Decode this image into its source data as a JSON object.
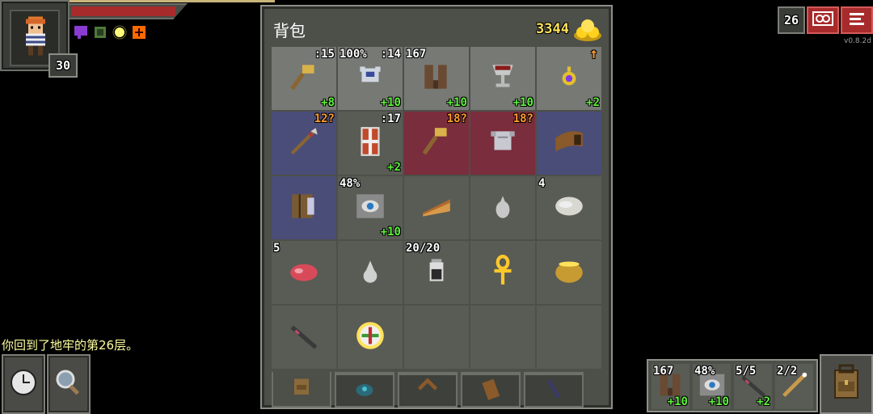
{
  "hero": {
    "level": "30",
    "hp_fraction": 0.92
  },
  "buffs": [
    "purple-buff-icon",
    "green-buff-icon",
    "light-buff-icon",
    "bless-buff-icon"
  ],
  "depth": "26",
  "version": "v0.8.2d",
  "log": {
    "message": "你回到了地牢的第26层。"
  },
  "bag": {
    "title": "背包",
    "gold": "3344",
    "slots": [
      {
        "icon": "hammer-icon",
        "style": "bright",
        "tl": "",
        "tr": ":15",
        "br": "+8"
      },
      {
        "icon": "armor-icon",
        "style": "bright",
        "tl": "100%",
        "tr": ":14",
        "br": "+10"
      },
      {
        "icon": "boots-icon",
        "style": "bright",
        "tl": "167",
        "tr": "",
        "br": "+10"
      },
      {
        "icon": "goblet-icon",
        "style": "bright",
        "tl": "",
        "tr": "",
        "br": "+10"
      },
      {
        "icon": "amulet-icon",
        "style": "bright",
        "tl": "",
        "tr": "↑",
        "br": "+2"
      },
      {
        "icon": "spear-icon",
        "style": "blue",
        "tl": "",
        "tr": "12?",
        "br": ""
      },
      {
        "icon": "shield-icon",
        "style": "normal",
        "tl": "",
        "tr": ":17",
        "br": "+2"
      },
      {
        "icon": "warhammer-icon",
        "style": "red",
        "tl": "",
        "tr": "18?",
        "br": ""
      },
      {
        "icon": "chestplate-icon",
        "style": "red",
        "tl": "",
        "tr": "18?",
        "br": ""
      },
      {
        "icon": "horn-icon",
        "style": "blue",
        "tl": "",
        "tr": "",
        "br": ""
      },
      {
        "icon": "spellbook-icon",
        "style": "blue",
        "tl": "",
        "tr": "",
        "br": ""
      },
      {
        "icon": "eye-artifact-icon",
        "style": "normal",
        "tl": "48%",
        "tr": "",
        "br": "+10"
      },
      {
        "icon": "pie-icon",
        "style": "normal",
        "tl": "",
        "tr": "",
        "br": ""
      },
      {
        "icon": "seed-icon",
        "style": "normal",
        "tl": "",
        "tr": "",
        "br": ""
      },
      {
        "icon": "stone-icon",
        "style": "normal",
        "tl": "4",
        "tr": "",
        "br": ""
      },
      {
        "icon": "meat-icon",
        "style": "normal",
        "tl": "5",
        "tr": "",
        "br": ""
      },
      {
        "icon": "dust-icon",
        "style": "normal",
        "tl": "",
        "tr": "",
        "br": ""
      },
      {
        "icon": "dew-vial-icon",
        "style": "normal",
        "tl": "20/20",
        "tr": "",
        "br": ""
      },
      {
        "icon": "ankh-icon",
        "style": "normal",
        "tl": "",
        "tr": "",
        "br": ""
      },
      {
        "icon": "honey-pot-icon",
        "style": "normal",
        "tl": "",
        "tr": "",
        "br": ""
      },
      {
        "icon": "wand-icon",
        "style": "normal",
        "tl": "",
        "tr": "",
        "br": ""
      },
      {
        "icon": "compass-icon",
        "style": "normal",
        "tl": "",
        "tr": "",
        "br": ""
      },
      {
        "icon": "",
        "style": "empty",
        "tl": "",
        "tr": "",
        "br": ""
      },
      {
        "icon": "",
        "style": "empty",
        "tl": "",
        "tr": "",
        "br": ""
      },
      {
        "icon": "",
        "style": "empty",
        "tl": "",
        "tr": "",
        "br": ""
      }
    ],
    "tabs": [
      "backpack-tab-icon",
      "gem-pouch-tab-icon",
      "boomerang-tab-icon",
      "scroll-holder-tab-icon",
      "wand-holster-tab-icon"
    ]
  },
  "quickslots": [
    {
      "icon": "boots-icon",
      "tl": "167",
      "br": "+10"
    },
    {
      "icon": "eye-artifact-icon",
      "tl": "48%",
      "br": "+10"
    },
    {
      "icon": "wand-icon",
      "tl": "5/5",
      "br": "+2"
    },
    {
      "icon": "staff-icon",
      "tl": "2/2",
      "br": ""
    }
  ]
}
